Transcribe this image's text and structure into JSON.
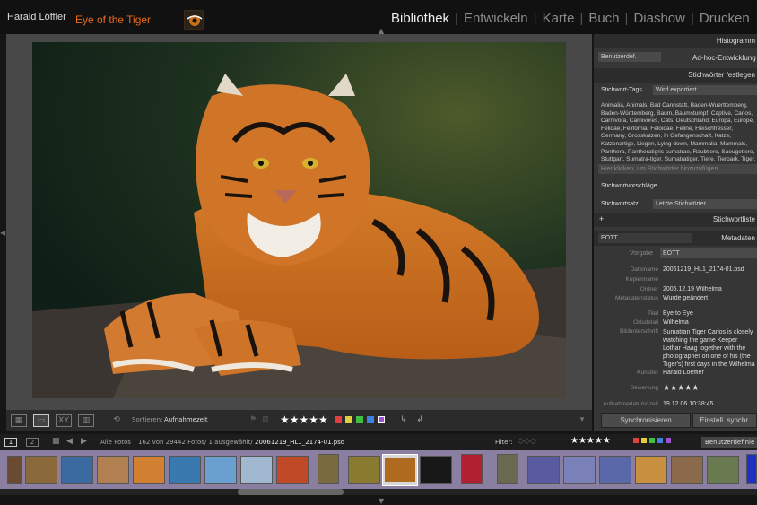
{
  "top": {
    "user": "Harald Löffler",
    "title": "Eye of the Tiger",
    "modules": [
      "Bibliothek",
      "Entwickeln",
      "Karte",
      "Buch",
      "Diashow",
      "Drucken"
    ],
    "active_module": "Bibliothek",
    "orange": "#e66a1a"
  },
  "toolbar": {
    "sort_label": "Sortieren:",
    "sort_value": "Aufnahmezeit",
    "stars": "★★★★★",
    "label_colors": [
      "#e04040",
      "#e0d040",
      "#40c040",
      "#4080e0",
      "#a050d0"
    ]
  },
  "right": {
    "histogram": "Histogramm",
    "quick_preset": "Benutzerdef.",
    "quick_dev": "Ad-hoc-Entwicklung",
    "keywords_header": "Stichwörter festlegen",
    "kw_tags_label": "Stichwort-Tags",
    "kw_tags_value": "Wird exportiert",
    "kw_text": "Animalia, Animals, Bad Cannstatt, Baden-Wuerttemberg, Baden-Württemberg, Baum, Baumstumpf, Captive, Carlos, Carnivora, Carnivores, Cats, Deutschland, Europa, Europe, Felidae, Felifornia, Feloidae, Feline, Fleischfresser, Germany, Grosskatzen, In Gefangenschaft, Katze, Katzenartige, Liegen, Lying down, Mammalia, Mammals, Panthera, Pantheratigris sumatrae, Raubtiere, Saeugetiere, Stuttgart, Sumatra-tiger, Sumatratiger, Tiere, Tierpark, Tiger, Tree, Tree Trunk, Wilhelma",
    "kw_input": "Hier klicken, um Stichwörter hinzuzufügen",
    "kw_suggestions": "Stichwortvorschläge",
    "kw_set_label": "Stichwortsatz",
    "kw_set_value": "Letzte Stichwörter",
    "plus": "+",
    "kw_list": "Stichwortliste",
    "meta_preset": "EOTT",
    "meta_header": "Metadaten",
    "vorgabe_label": "Vorgabe",
    "vorgabe_value": "EOTT",
    "meta": [
      {
        "label": "Dateiname",
        "value": "20061219_HL1_2174-01.psd"
      },
      {
        "label": "Kopienname",
        "value": ""
      },
      {
        "label": "Ordner",
        "value": "2006.12.19 Wilhelma"
      },
      {
        "label": "Metadatenstatus",
        "value": "Wurde geändert"
      },
      {
        "label": "Titel",
        "value": "Eye to Eye"
      },
      {
        "label": "Ortsdetail",
        "value": "Wilhelma"
      },
      {
        "label": "Bildunterschrift",
        "value": "Sumatran Tiger Carlos is closely watching the game Keeper Lothar Haag together with the photographer on one of his (the Tiger's) first days in the Wilhelma zoo in Stuttgart"
      },
      {
        "label": "Künstler",
        "value": "Harald Loeffler"
      },
      {
        "label": "Bewertung",
        "value": "★★★★★"
      },
      {
        "label": "Aufnahmedatum/-zeit",
        "value": "19.12.06 10:38:45"
      }
    ],
    "sync_button": "Synchronisieren",
    "sync_settings": "Einstell. synchr."
  },
  "filmbar": {
    "page1": "1",
    "page2": "2",
    "source": "Alle Fotos",
    "count": "162 von 29442 Fotos/ 1 ausgewählt/",
    "filename": "20061219_HL1_2174-01.psd",
    "filter_label": "Filter:",
    "filter_stars": "★★★★★",
    "filter_preset": "Benutzerdefinie"
  }
}
